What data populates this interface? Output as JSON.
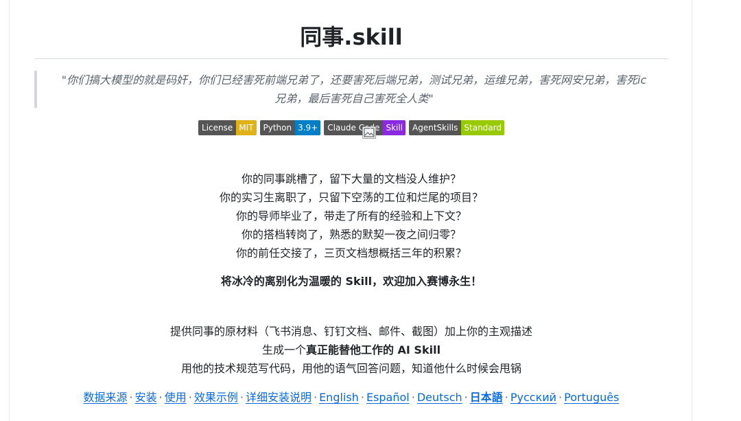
{
  "title": "同事.skill",
  "quote": "\"你们搞大模型的就是码奸，你们已经害死前端兄弟了，还要害死后端兄弟，测试兄弟，运维兄弟，害死网安兄弟，害死ic兄弟，最后害死自己害死全人类\"",
  "badges": [
    {
      "label": "License",
      "value": "MIT",
      "color": "#dfb317"
    },
    {
      "label": "Python",
      "value": "3.9+",
      "color": "#007ec6"
    },
    {
      "label": "Claude Code",
      "value": "Skill",
      "color": "#8a2be2"
    },
    {
      "label": "AgentSkills",
      "value": "Standard",
      "color": "#97ca00"
    }
  ],
  "broken_image_icon": "broken-image-icon",
  "pain_points": [
    "你的同事跳槽了，留下大量的文档没人维护？",
    "你的实习生离职了，只留下空荡的工位和烂尾的项目？",
    "你的导师毕业了，带走了所有的经验和上下文？",
    "你的搭档转岗了，熟悉的默契一夜之间归零？",
    "你的前任交接了，三页文档想概括三年的积累？"
  ],
  "tagline": "将冰冷的离别化为温暖的 Skill，欢迎加入赛博永生！",
  "features": {
    "line1": "提供同事的原材料（飞书消息、钉钉文档、邮件、截图）加上你的主观描述",
    "line2_pre": "生成一个",
    "line2_bold": "真正能替他工作的 AI Skill",
    "line3": "用他的技术规范写代码，用他的语气回答问题，知道他什么时候会甩锅"
  },
  "nav_links": [
    {
      "label": "数据来源",
      "bold": false
    },
    {
      "label": "安装",
      "bold": false
    },
    {
      "label": "使用",
      "bold": false
    },
    {
      "label": "效果示例",
      "bold": false
    },
    {
      "label": "详细安装说明",
      "bold": false
    },
    {
      "label": "English",
      "bold": false
    },
    {
      "label": "Español",
      "bold": false
    },
    {
      "label": "Deutsch",
      "bold": false
    },
    {
      "label": "日本語",
      "bold": true
    },
    {
      "label": "Русский",
      "bold": false
    },
    {
      "label": "Português",
      "bold": false
    }
  ],
  "nav_separator": "·"
}
